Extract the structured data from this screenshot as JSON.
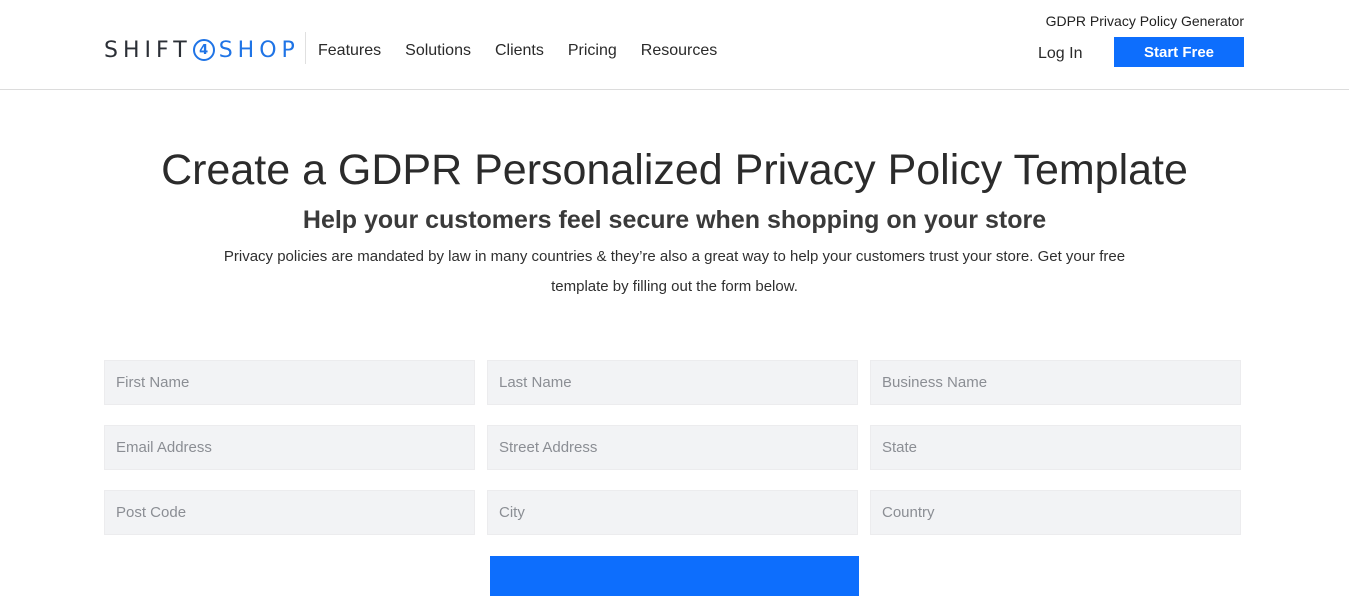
{
  "header": {
    "logo_left": "SHIFT",
    "logo_digit": "4",
    "logo_right": "SHOP",
    "nav": [
      "Features",
      "Solutions",
      "Clients",
      "Pricing",
      "Resources"
    ],
    "gdpr_link": "GDPR Privacy Policy Generator",
    "login": "Log In",
    "start_free": "Start Free"
  },
  "hero": {
    "title": "Create a GDPR Personalized Privacy Policy Template",
    "subtitle": "Help your customers feel secure when shopping on your store",
    "description": "Privacy policies are mandated by law in many countries & they’re also a great way to help your customers trust your store. Get your free template by filling out the form below."
  },
  "form": {
    "first_name": "First Name",
    "last_name": "Last Name",
    "business_name": "Business Name",
    "email": "Email Address",
    "street": "Street Address",
    "state": "State",
    "post_code": "Post Code",
    "city": "City",
    "country": "Country"
  },
  "colors": {
    "accent": "#0d6efd",
    "brand_blue": "#1f74e6",
    "field_bg": "#f2f3f5"
  }
}
